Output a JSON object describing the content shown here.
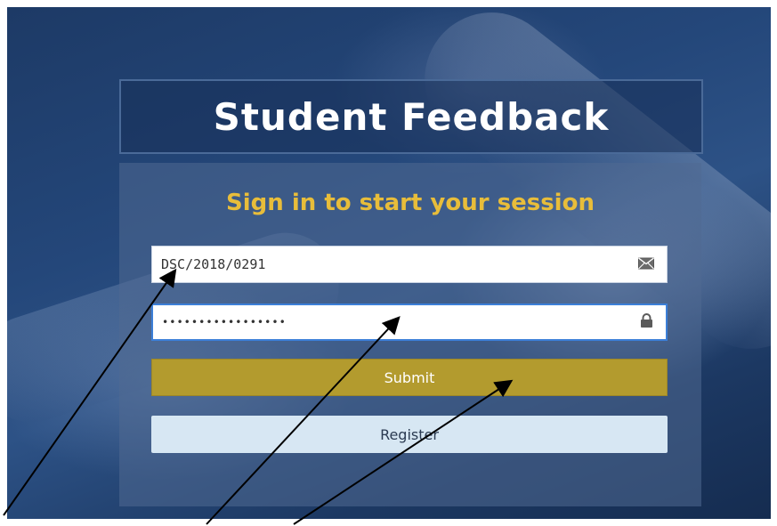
{
  "header": {
    "title": "Student Feedback"
  },
  "login": {
    "subtitle": "Sign in to start your session",
    "username": {
      "value": "DSC/2018/0291",
      "icon": "envelope-icon"
    },
    "password": {
      "value": "•••••••••••••••••",
      "icon": "lock-icon"
    },
    "submit_label": "Submit",
    "register_label": "Register"
  },
  "colors": {
    "accent_gold": "#e8bd3a",
    "submit_bg": "#b39b2e",
    "register_bg": "#d7e7f3",
    "background": "#24477a"
  }
}
